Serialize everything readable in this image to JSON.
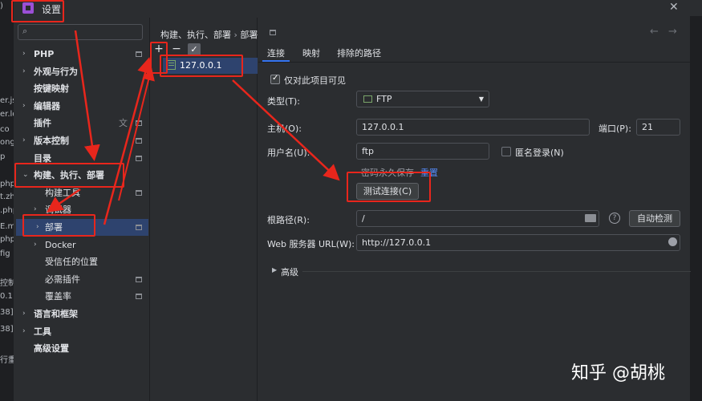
{
  "window": {
    "title": "设置",
    "close_glyph": "✕"
  },
  "background_ide": {
    "left_fragments": [
      ")",
      "er.js",
      "er.lo",
      "co",
      "ong",
      "p",
      "php",
      "t.zh",
      ".php",
      "E.m",
      "php",
      "fig",
      "控制",
      "0.1",
      "38]",
      "38]",
      "行重"
    ]
  },
  "sidebar": {
    "search_placeholder": "",
    "items": [
      {
        "label": "PHP",
        "arrow": "›",
        "bold": true,
        "badge": true
      },
      {
        "label": "外观与行为",
        "arrow": "›",
        "bold": true,
        "badge": false
      },
      {
        "label": "按键映射",
        "arrow": "",
        "bold": true,
        "badge": false
      },
      {
        "label": "编辑器",
        "arrow": "›",
        "bold": true,
        "badge": false
      },
      {
        "label": "插件",
        "arrow": "",
        "bold": true,
        "badge": true,
        "glyph": "文"
      },
      {
        "label": "版本控制",
        "arrow": "›",
        "bold": true,
        "badge": true
      },
      {
        "label": "目录",
        "arrow": "",
        "bold": true,
        "badge": true
      },
      {
        "label": "构建、执行、部署",
        "arrow": "⌄",
        "bold": true,
        "badge": false
      },
      {
        "label": "构建工具",
        "arrow": "",
        "bold": false,
        "badge": true
      },
      {
        "label": "调试器",
        "arrow": "›",
        "bold": false,
        "badge": false
      },
      {
        "label": "部署",
        "arrow": "›",
        "bold": false,
        "badge": true,
        "selected": true
      },
      {
        "label": "Docker",
        "arrow": "›",
        "bold": false,
        "badge": false
      },
      {
        "label": "受信任的位置",
        "arrow": "",
        "bold": false,
        "badge": false
      },
      {
        "label": "必需插件",
        "arrow": "",
        "bold": false,
        "badge": true
      },
      {
        "label": "覆盖率",
        "arrow": "",
        "bold": false,
        "badge": true
      },
      {
        "label": "语言和框架",
        "arrow": "›",
        "bold": true,
        "badge": false
      },
      {
        "label": "工具",
        "arrow": "›",
        "bold": true,
        "badge": false
      },
      {
        "label": "高级设置",
        "arrow": "",
        "bold": true,
        "badge": false
      }
    ]
  },
  "servers": {
    "add": "+",
    "remove": "−",
    "default_check": "✓",
    "selected_server": "127.0.0.1"
  },
  "breadcrumb": {
    "parent": "构建、执行、部署",
    "sep": "›",
    "current": "部署",
    "back": "←",
    "forward": "→"
  },
  "tabs": [
    "连接",
    "映射",
    "排除的路径"
  ],
  "form": {
    "project_only_label": "仅对此项目可见",
    "type_label": "类型(T):",
    "type_value": "FTP",
    "host_label": "主机(O):",
    "host_value": "127.0.0.1",
    "port_label": "端口(P):",
    "port_value": "21",
    "user_label": "用户名(U):",
    "user_value": "ftp",
    "anon_label": "匿名登录(N)",
    "pwd_note": "密码永久保存",
    "reset_link": "重置",
    "test_btn": "测试连接(C)",
    "root_label": "根路径(R):",
    "root_value": "/",
    "auto_detect": "自动检测",
    "web_label": "Web 服务器 URL(W):",
    "web_value": "http://127.0.0.1",
    "advanced": "高级"
  },
  "watermark": "知乎 @胡桃",
  "colors": {
    "accent": "#3574f0",
    "selection": "#2e436e",
    "annotation": "#e8261c"
  }
}
